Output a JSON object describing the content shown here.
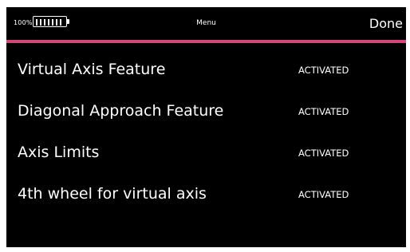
{
  "status_bar": {
    "battery_percent": "100%",
    "battery_level": 1.0
  },
  "header": {
    "title": "Menu",
    "done_label": "Done"
  },
  "colors": {
    "background": "#000000",
    "accent": "#d4457a",
    "text": "#ffffff"
  },
  "features": [
    {
      "label": "Virtual Axis Feature",
      "status": "ACTIVATED"
    },
    {
      "label": "Diagonal Approach Feature",
      "status": "ACTIVATED"
    },
    {
      "label": "Axis Limits",
      "status": "ACTIVATED"
    },
    {
      "label": "4th wheel for virtual axis",
      "status": "ACTIVATED"
    }
  ]
}
